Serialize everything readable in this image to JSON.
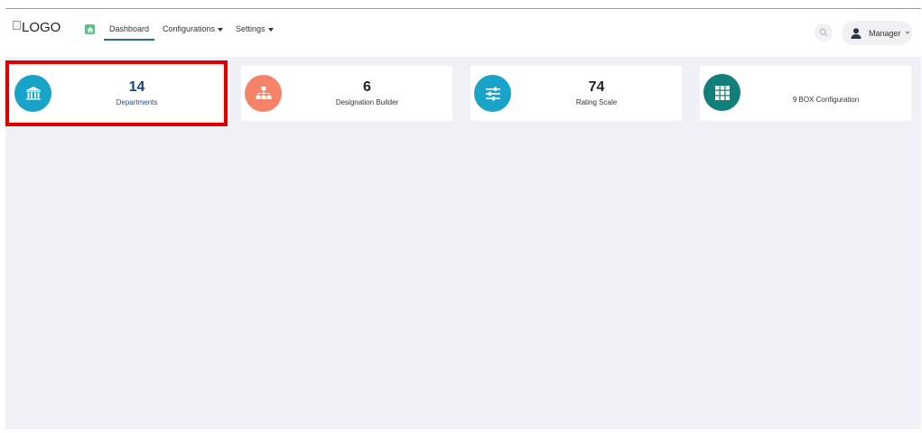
{
  "header": {
    "logo_alt": "LOGO",
    "nav": {
      "dashboard": "Dashboard",
      "configurations": "Configurations",
      "settings": "Settings"
    },
    "user_label": "Manager"
  },
  "cards": [
    {
      "count": "14",
      "label": "Departments",
      "icon": "bank-icon",
      "color": "#1aa3c9"
    },
    {
      "count": "6",
      "label": "Designation Builder",
      "icon": "sitemap-icon",
      "color": "#f4836a"
    },
    {
      "count": "74",
      "label": "Rating Scale",
      "icon": "sliders-icon",
      "color": "#1aa3c9"
    },
    {
      "count": "",
      "label": "9 BOX Configuration",
      "icon": "grid-icon",
      "color": "#127f7a"
    }
  ],
  "colors": {
    "highlight": "#e00000",
    "content_bg": "#f0f1f6",
    "home": "#5cc08a",
    "active_underline": "#1e6f8c"
  }
}
